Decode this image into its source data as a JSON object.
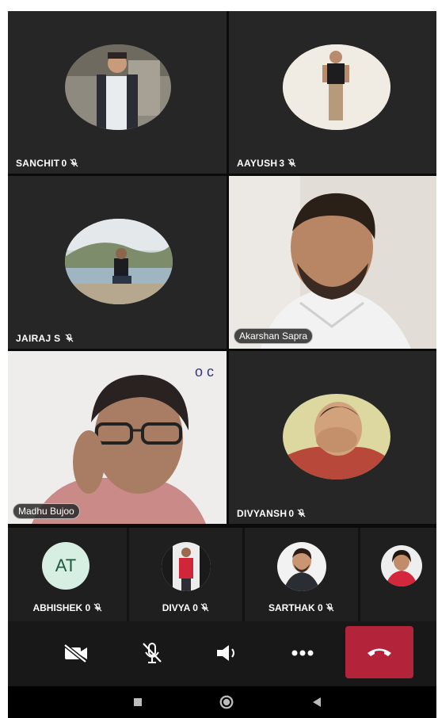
{
  "participants": [
    {
      "name": "SANCHIT",
      "count": "0"
    },
    {
      "name": "AAYUSH",
      "count": "3"
    },
    {
      "name": "JAIRAJ S",
      "count": ""
    },
    {
      "name": "Akarshan Sapra"
    },
    {
      "name": "Madhu Bujoo"
    },
    {
      "name": "DIVYANSH",
      "count": "0"
    }
  ],
  "strip": [
    {
      "name": "ABHISHEK",
      "count": "0",
      "initials": "AT"
    },
    {
      "name": "DIVYA",
      "count": "0"
    },
    {
      "name": "SARTHAK",
      "count": "0"
    },
    {
      "name": ""
    }
  ],
  "controls": {
    "camera_icon": "camera-off-icon",
    "mic_icon": "mic-off-icon",
    "speaker_icon": "speaker-icon",
    "more_icon": "more-icon",
    "hangup_icon": "hang-up-icon"
  },
  "colors": {
    "hangup": "#b3243b",
    "tile": "#262626",
    "avatar_initials_bg": "#d7efe2"
  }
}
